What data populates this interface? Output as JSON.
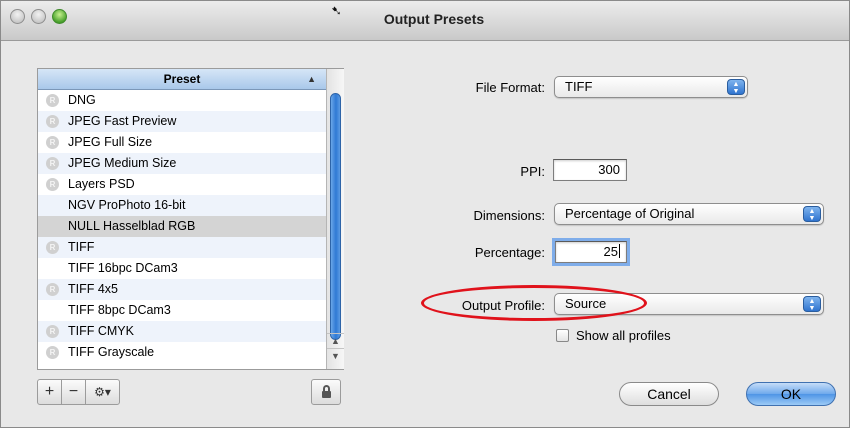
{
  "window": {
    "title": "Output Presets"
  },
  "preset_list": {
    "header": "Preset",
    "sort_indicator": "▲",
    "items": [
      {
        "label": "DNG",
        "builtin": true
      },
      {
        "label": "JPEG Fast Preview",
        "builtin": true
      },
      {
        "label": "JPEG Full Size",
        "builtin": true
      },
      {
        "label": "JPEG Medium Size",
        "builtin": true
      },
      {
        "label": "Layers PSD",
        "builtin": true
      },
      {
        "label": "NGV ProPhoto 16-bit",
        "builtin": false
      },
      {
        "label": "NULL Hasselblad RGB",
        "builtin": false,
        "selected": true
      },
      {
        "label": "TIFF",
        "builtin": true
      },
      {
        "label": "TIFF 16bpc DCam3",
        "builtin": false
      },
      {
        "label": "TIFF 4x5",
        "builtin": true
      },
      {
        "label": "TIFF 8bpc DCam3",
        "builtin": false
      },
      {
        "label": "TIFF CMYK",
        "builtin": true
      },
      {
        "label": "TIFF Grayscale",
        "builtin": true
      }
    ],
    "builtin_icon_glyph": "R"
  },
  "toolbar": {
    "add_label": "+",
    "remove_label": "−",
    "action_label": "⚙▾"
  },
  "form": {
    "file_format_label": "File Format:",
    "file_format_value": "TIFF",
    "ppi_label": "PPI:",
    "ppi_value": "300",
    "dimensions_label": "Dimensions:",
    "dimensions_value": "Percentage of Original",
    "percentage_label": "Percentage:",
    "percentage_value": "25",
    "output_profile_label": "Output Profile:",
    "output_profile_value": "Source",
    "show_all_profiles_label": "Show all profiles",
    "show_all_profiles_checked": false
  },
  "buttons": {
    "cancel_label": "Cancel",
    "ok_label": "OK"
  },
  "colors": {
    "highlight_ellipse": "#e0121b",
    "accent_blue": "#2f79d4"
  }
}
